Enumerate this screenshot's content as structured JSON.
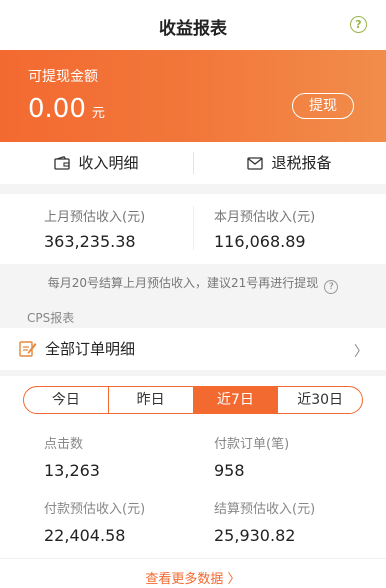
{
  "header": {
    "title": "收益报表",
    "help_glyph": "?"
  },
  "balance": {
    "label": "可提现金额",
    "amount": "0.00",
    "unit": "元",
    "withdraw_label": "提现"
  },
  "actions": {
    "income_detail": "收入明细",
    "tax_refund": "退税报备"
  },
  "estimates": {
    "last_month_label": "上月预估收入(元)",
    "last_month_value": "363,235.38",
    "this_month_label": "本月预估收入(元)",
    "this_month_value": "116,068.89"
  },
  "notice": {
    "text": "每月20号结算上月预估收入，建议21号再进行提现",
    "help_glyph": "?"
  },
  "cps": {
    "section_label": "CPS报表",
    "all_orders_label": "全部订单明细",
    "arrow": "〉"
  },
  "tabs": [
    {
      "label": "今日",
      "active": false
    },
    {
      "label": "昨日",
      "active": false
    },
    {
      "label": "近7日",
      "active": true
    },
    {
      "label": "近30日",
      "active": false
    }
  ],
  "stats": {
    "clicks_label": "点击数",
    "clicks_value": "13,263",
    "paid_orders_label": "付款订单(笔)",
    "paid_orders_value": "958",
    "paid_income_label": "付款预估收入(元)",
    "paid_income_value": "22,404.58",
    "settle_income_label": "结算预估收入(元)",
    "settle_income_value": "25,930.82"
  },
  "more_label": "查看更多数据 〉",
  "colors": {
    "accent": "#f36a31",
    "help": "#9ab54a"
  }
}
